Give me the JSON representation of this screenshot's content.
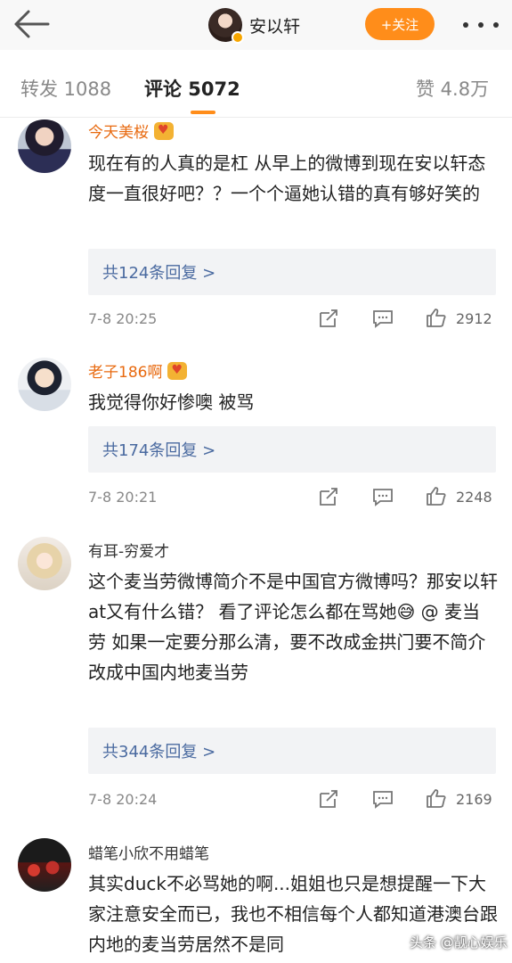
{
  "header": {
    "user_name": "安以轩",
    "follow_label": "+关注"
  },
  "tabs": {
    "repost": "转发 1088",
    "comments": "评论 5072",
    "likes": "赞 4.8万"
  },
  "comments": [
    {
      "name": "今天美桜",
      "text": "现在有的人真的是杠 从早上的微博到现在安以轩态度一直很好吧？？一个个逼她认错的真有够好笑的",
      "replies": "共124条回复 >",
      "time": "7-8 20:25",
      "likes": "2912"
    },
    {
      "name": "老子186啊",
      "text": "我觉得你好惨噢 被骂",
      "replies": "共174条回复 >",
      "time": "7-8 20:21",
      "likes": "2248"
    },
    {
      "name": "有耳-穷爱才",
      "text": "这个麦当劳微博简介不是中国官方微博吗？那安以轩at又有什么错？ 看了评论怎么都在骂她😅 @ 麦当劳 如果一定要分那么清，要不改成金拱门要不简介改成中国内地麦当劳",
      "replies": "共344条回复 >",
      "time": "7-8 20:24",
      "likes": "2169"
    },
    {
      "name": "蜡笔小欣不用蜡笔",
      "text": "其实duck不必骂她的啊...姐姐也只是想提醒一下大家注意安全而已，我也不相信每个人都知道港澳台跟内地的麦当劳居然不是同"
    }
  ],
  "watermark": "头条 @靓心娱乐",
  "colors": {
    "accent": "#ff8d1a",
    "username": "#e86a10",
    "link": "#4a6aa0"
  }
}
